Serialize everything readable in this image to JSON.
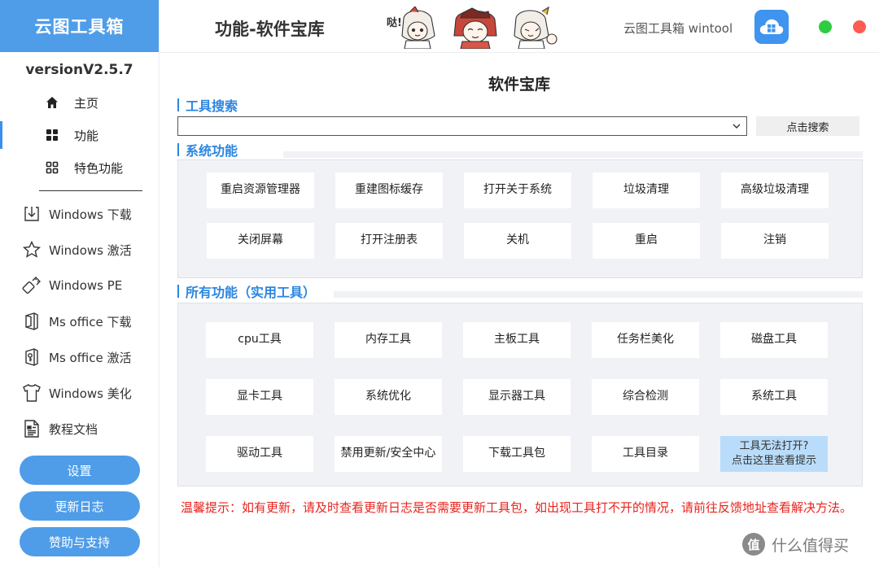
{
  "sidebar": {
    "brand": "云图工具箱",
    "version": "versionV2.5.7",
    "nav": [
      {
        "label": "主页",
        "icon": "home-icon"
      },
      {
        "label": "功能",
        "icon": "grid-icon"
      },
      {
        "label": "特色功能",
        "icon": "grid-outline-icon"
      }
    ],
    "tools": [
      {
        "label": "Windows 下载",
        "icon": "download-icon"
      },
      {
        "label": "Windows 激活",
        "icon": "star-icon"
      },
      {
        "label": "Windows PE",
        "icon": "usb-icon"
      },
      {
        "label": "Ms office 下载",
        "icon": "office-icon"
      },
      {
        "label": "Ms office 激活",
        "icon": "office-key-icon"
      },
      {
        "label": "Windows 美化",
        "icon": "tshirt-icon"
      },
      {
        "label": "教程文档",
        "icon": "document-icon"
      }
    ],
    "buttons": {
      "settings": "设置",
      "changelog": "更新日志",
      "support": "赞助与支持"
    }
  },
  "header": {
    "title": "功能-软件宝库",
    "brand_label": "云图工具箱 wintool",
    "mascot_text": "哒!"
  },
  "main": {
    "title": "软件宝库",
    "search": {
      "label": "工具搜索",
      "value": "",
      "button": "点击搜索"
    },
    "system": {
      "label": "系统功能",
      "buttons": [
        "重启资源管理器",
        "重建图标缓存",
        "打开关于系统",
        "垃圾清理",
        "高级垃圾清理",
        "关闭屏幕",
        "打开注册表",
        "关机",
        "重启",
        "注销"
      ]
    },
    "all": {
      "label": "所有功能（实用工具）",
      "buttons": [
        "cpu工具",
        "内存工具",
        "主板工具",
        "任务栏美化",
        "磁盘工具",
        "显卡工具",
        "系统优化",
        "显示器工具",
        "综合检测",
        "系统工具",
        "驱动工具",
        "禁用更新/安全中心",
        "下载工具包",
        "工具目录"
      ],
      "help_line1": "工具无法打开?",
      "help_line2": "点击这里查看提示"
    },
    "notice": "温馨提示：如有更新，请及时查看更新日志是否需要更新工具包，如出现工具打不开的情况，请前往反馈地址查看解决方法。"
  },
  "watermark": {
    "text": "什么值得买",
    "badge": "值"
  },
  "colors": {
    "brand": "#4f9de8",
    "accent": "#2b86e0",
    "notice": "#e8231d",
    "hint": "#b9dcfa",
    "close": "#ff5b50",
    "minimize": "#2ecc40"
  }
}
